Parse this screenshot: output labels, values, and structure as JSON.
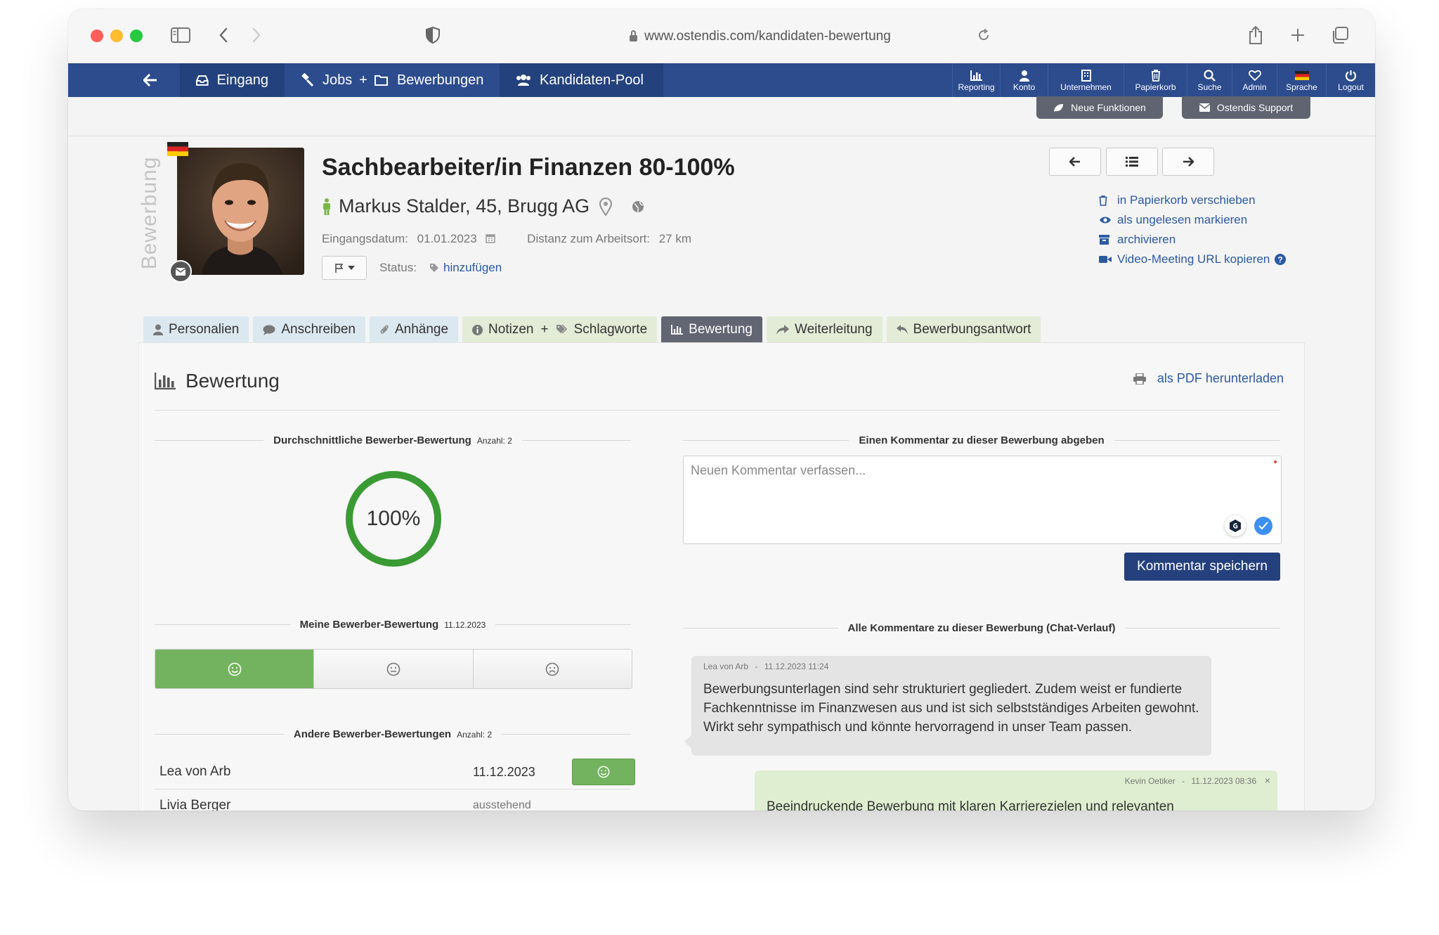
{
  "browser": {
    "url": "www.ostendis.com/kandidaten-bewertung",
    "traffic_colors": [
      "#ff5f57",
      "#febc2e",
      "#28c840"
    ]
  },
  "nav": {
    "back_icon": "arrow-left-icon",
    "inbox": "Eingang",
    "jobs": "Jobs",
    "plus": "+",
    "applications": "Bewerbungen",
    "pool": "Kandidaten-Pool",
    "right": [
      {
        "icon": "bar-chart-icon",
        "label": "Reporting"
      },
      {
        "icon": "user-icon",
        "label": "Konto"
      },
      {
        "icon": "building-icon",
        "label": "Unternehmen"
      },
      {
        "icon": "trash-icon",
        "label": "Papierkorb"
      },
      {
        "icon": "search-icon",
        "label": "Suche"
      },
      {
        "icon": "heart-icon",
        "label": "Admin"
      },
      {
        "icon": "flag-de-icon",
        "label": "Sprache"
      },
      {
        "icon": "power-icon",
        "label": "Logout"
      }
    ]
  },
  "pills": {
    "new_features": "Neue Funktionen",
    "support": "Ostendis Support"
  },
  "header": {
    "vertical_label": "Bewerbung",
    "job_title": "Sachbearbeiter/in Finanzen 80-100%",
    "candidate": "Markus Stalder, 45, Brugg AG",
    "received_label": "Eingangsdatum:",
    "received_value": "01.01.2023",
    "distance_label": "Distanz zum Arbeitsort:",
    "distance_value": "27 km",
    "status_label": "Status:",
    "status_link": "hinzufügen"
  },
  "actions": [
    {
      "icon": "trash-icon",
      "label": "in Papierkorb verschieben"
    },
    {
      "icon": "eye-icon",
      "label": "als ungelesen markieren"
    },
    {
      "icon": "archive-icon",
      "label": "archivieren"
    },
    {
      "icon": "video-icon",
      "label": "Video-Meeting URL kopieren"
    }
  ],
  "tabs": [
    {
      "label": "Personalien",
      "style": "blue"
    },
    {
      "label": "Anschreiben",
      "style": "blue"
    },
    {
      "label": "Anhänge",
      "style": "blue"
    },
    {
      "label": "Notizen",
      "style": "green"
    },
    {
      "label": "Bewertung",
      "style": "active"
    },
    {
      "label": "Weiterleitung",
      "style": "green"
    },
    {
      "label": "Bewerbungsantwort",
      "style": "green"
    }
  ],
  "notes_plus": "+",
  "notes_tags": "Schlagworte",
  "panel": {
    "title": "Bewertung",
    "pdf_link": "als PDF herunterladen"
  },
  "avg": {
    "title": "Durchschnittliche Bewerber-Bewertung",
    "count": "Anzahl: 2",
    "percent": "100%",
    "percent_value": 100
  },
  "mine": {
    "title": "Meine Bewerber-Bewertung",
    "date": "11.12.2023",
    "selected": "positive"
  },
  "others": {
    "title": "Andere Bewerber-Bewertungen",
    "count": "Anzahl: 2",
    "rows": [
      {
        "name": "Lea von Arb",
        "date": "11.12.2023",
        "rating": "positive"
      },
      {
        "name": "Livia Berger",
        "date": "ausstehend",
        "rating": ""
      }
    ]
  },
  "comment": {
    "title": "Einen Kommentar zu dieser Bewerbung abgeben",
    "placeholder": "Neuen Kommentar verfassen...",
    "save": "Kommentar speichern",
    "history_title": "Alle Kommentare zu dieser Bewerbung (Chat-Verlauf)",
    "messages": [
      {
        "author": "Lea von Arb",
        "sep": "-",
        "time": "11.12.2023 11:24",
        "text": "Bewerbungsunterlagen sind sehr strukturiert gegliedert. Zudem weist er fundierte Fachkenntnisse im Finanzwesen aus und ist sich selbstständiges Arbeiten gewohnt. Wirkt sehr sympathisch und könnte hervorragend in unser Team passen."
      },
      {
        "author": "Kevin Oetiker",
        "sep": "-",
        "time": "11.12.2023 08:36",
        "close": "×",
        "text": "Beeindruckende Bewerbung mit klaren Karrierezielen und relevanten"
      }
    ]
  }
}
